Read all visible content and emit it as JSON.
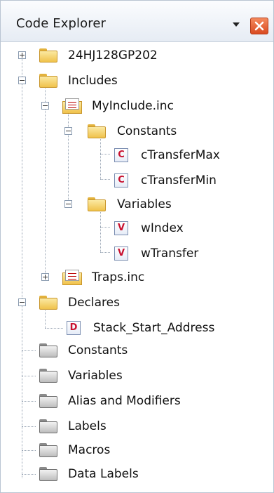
{
  "panel": {
    "title": "Code Explorer"
  },
  "tree": {
    "device": "24HJ128GP202",
    "includes": "Includes",
    "myinclude": "MyInclude.inc",
    "constants_inner": "Constants",
    "c_max": "cTransferMax",
    "c_min": "cTransferMin",
    "variables_inner": "Variables",
    "v_index": "wIndex",
    "v_transfer": "wTransfer",
    "traps": "Traps.inc",
    "declares": "Declares",
    "stack_start": "Stack_Start_Address",
    "constants": "Constants",
    "variables": "Variables",
    "alias": "Alias and Modifiers",
    "labels": "Labels",
    "macros": "Macros",
    "data_labels": "Data Labels"
  },
  "badges": {
    "constant": "C",
    "variable": "V",
    "declare": "D"
  },
  "colors": {
    "badge_text": "#c8102e",
    "close_button": "#e05a2c",
    "folder_yellow": "#f0c24b",
    "folder_gray": "#bdbdbd"
  }
}
